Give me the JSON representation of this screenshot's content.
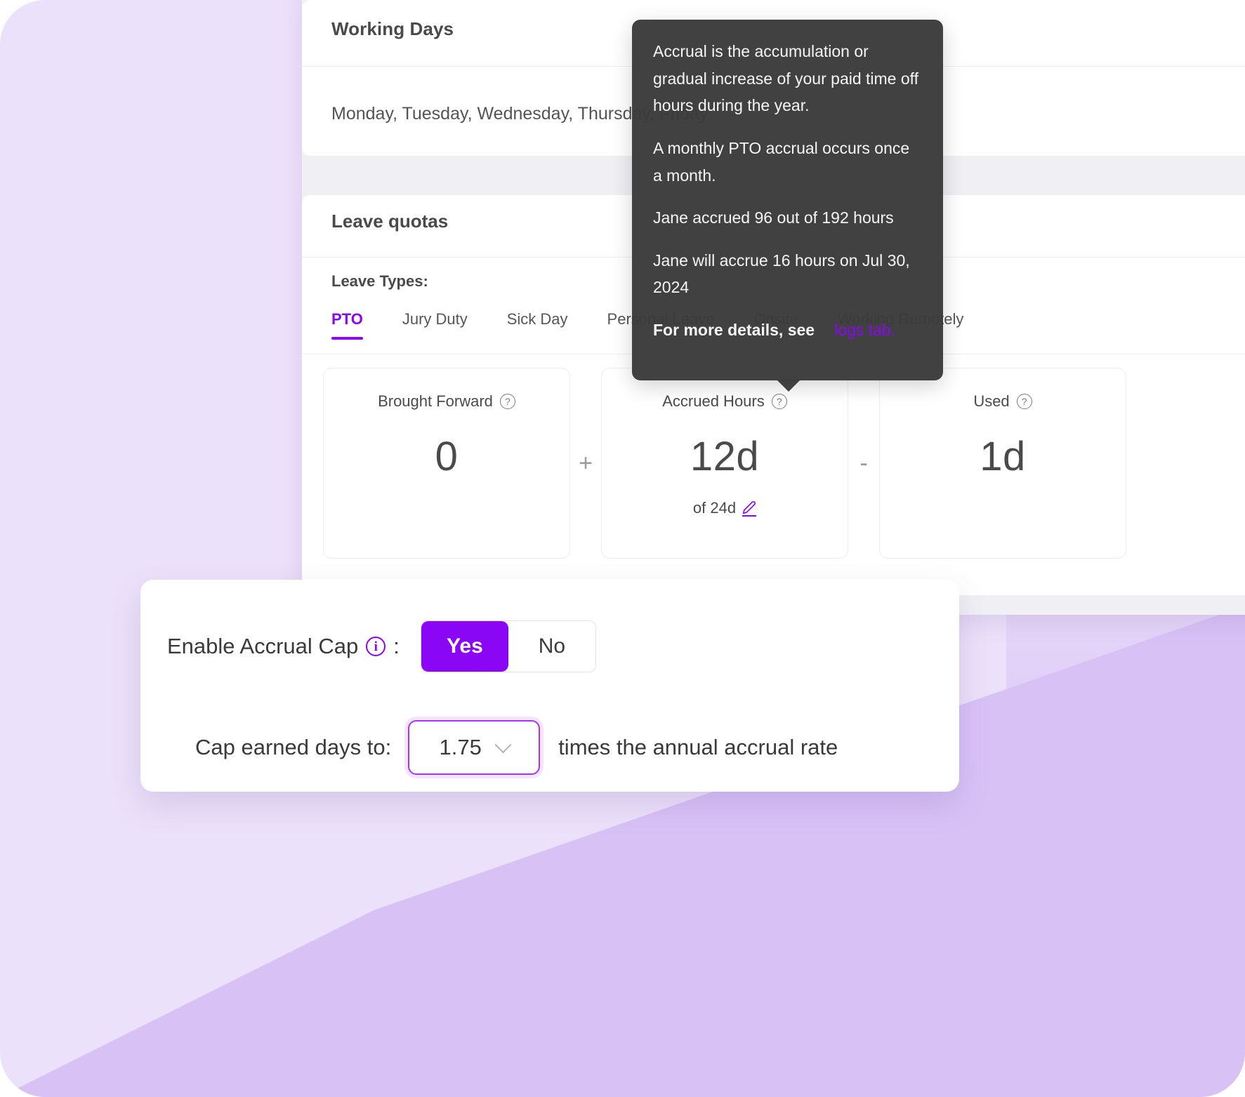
{
  "theme": {
    "accent": "#8b06f5",
    "accent_soft": "#a733f7",
    "background": "#ece1fa",
    "background_wedge": "#d8c2f5",
    "tooltip_bg": "#3a3a3a",
    "text": "#4a4a4a"
  },
  "working_days": {
    "title": "Working Days",
    "value": "Monday, Tuesday, Wednesday, Thursday, Friday"
  },
  "leave_quotas": {
    "title": "Leave quotas",
    "leave_types_label": "Leave Types:",
    "tabs": [
      {
        "label": "PTO",
        "active": true
      },
      {
        "label": "Jury Duty",
        "active": false
      },
      {
        "label": "Sick Day",
        "active": false
      },
      {
        "label": "Personal Leave",
        "active": false
      },
      {
        "label": "Onsite",
        "active": false
      },
      {
        "label": "Working Remotely",
        "active": false
      }
    ],
    "stats": [
      {
        "label": "Brought Forward",
        "help_icon": "question-mark-circle-icon",
        "value": "0",
        "sub": "",
        "operator_after": "+"
      },
      {
        "label": "Accrued Hours",
        "help_icon": "question-mark-circle-icon",
        "value": "12d",
        "sub": "of 24d",
        "sub_icon": "pencil-edit-icon",
        "operator_after": "-"
      },
      {
        "label": "Used",
        "help_icon": "question-mark-circle-icon",
        "value": "1d",
        "sub": "",
        "operator_after": ""
      }
    ]
  },
  "tooltip": {
    "paragraphs": [
      "Accrual is the accumulation or gradual increase of your paid time off hours during the year.",
      "A monthly PTO accrual occurs once a month.",
      "Jane accrued 96 out of 192 hours",
      "Jane will accrue 16 hours on Jul 30, 2024"
    ],
    "footer_text": "For more details, see",
    "footer_link": "logs tab."
  },
  "accrual_cap": {
    "enable_label": "Enable Accrual Cap",
    "enable_info_icon": "info-circle-icon",
    "colon": ":",
    "toggle": {
      "yes_label": "Yes",
      "no_label": "No",
      "selected": "Yes"
    },
    "cap_label": "Cap earned days to:",
    "cap_value": "1.75",
    "cap_dropdown_icon": "chevron-down-icon",
    "cap_suffix": "times the annual accrual rate"
  }
}
